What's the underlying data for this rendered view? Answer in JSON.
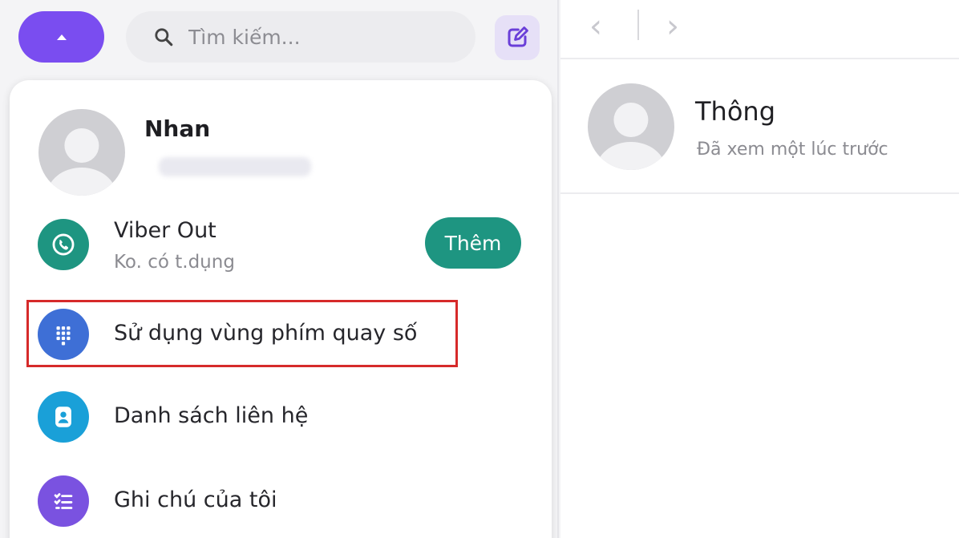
{
  "search": {
    "placeholder": "Tìm kiếm..."
  },
  "profile": {
    "name": "Nhan"
  },
  "menu": {
    "viber_out": {
      "label": "Viber Out",
      "sub": "Ko. có t.dụng",
      "action": "Thêm"
    },
    "dialpad": {
      "label": "Sử dụng vùng phím quay số"
    },
    "contacts": {
      "label": "Danh sách liên hệ"
    },
    "notes": {
      "label": "Ghi chú của tôi"
    }
  },
  "chat": {
    "name": "Thông",
    "status": "Đã xem một lúc trước"
  },
  "colors": {
    "accent": "#7a4df0",
    "viber_out": "#1e9581",
    "dialpad": "#3e6fd6",
    "contacts": "#1aa0d8",
    "notes": "#7a52e0",
    "highlight": "#d62a2a"
  }
}
